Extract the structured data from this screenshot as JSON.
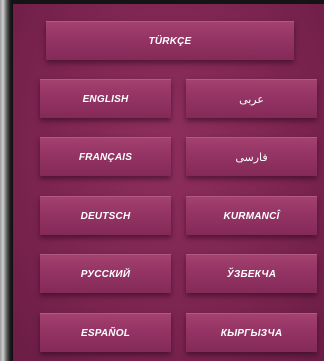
{
  "languages": {
    "featured": "TÜRKÇE",
    "rows": [
      [
        "ENGLISH",
        "عربى"
      ],
      [
        "FRANÇAIS",
        "فارسى"
      ],
      [
        "DEUTSCH",
        "KURMANCÎ"
      ],
      [
        "РУССКИЙ",
        "ЎЗБЕКЧА"
      ],
      [
        "ESPAÑOL",
        "КЫРГЫЗЧА"
      ]
    ]
  },
  "colors": {
    "background": "#7d2551",
    "button": "#943464",
    "text": "#ffffff"
  }
}
